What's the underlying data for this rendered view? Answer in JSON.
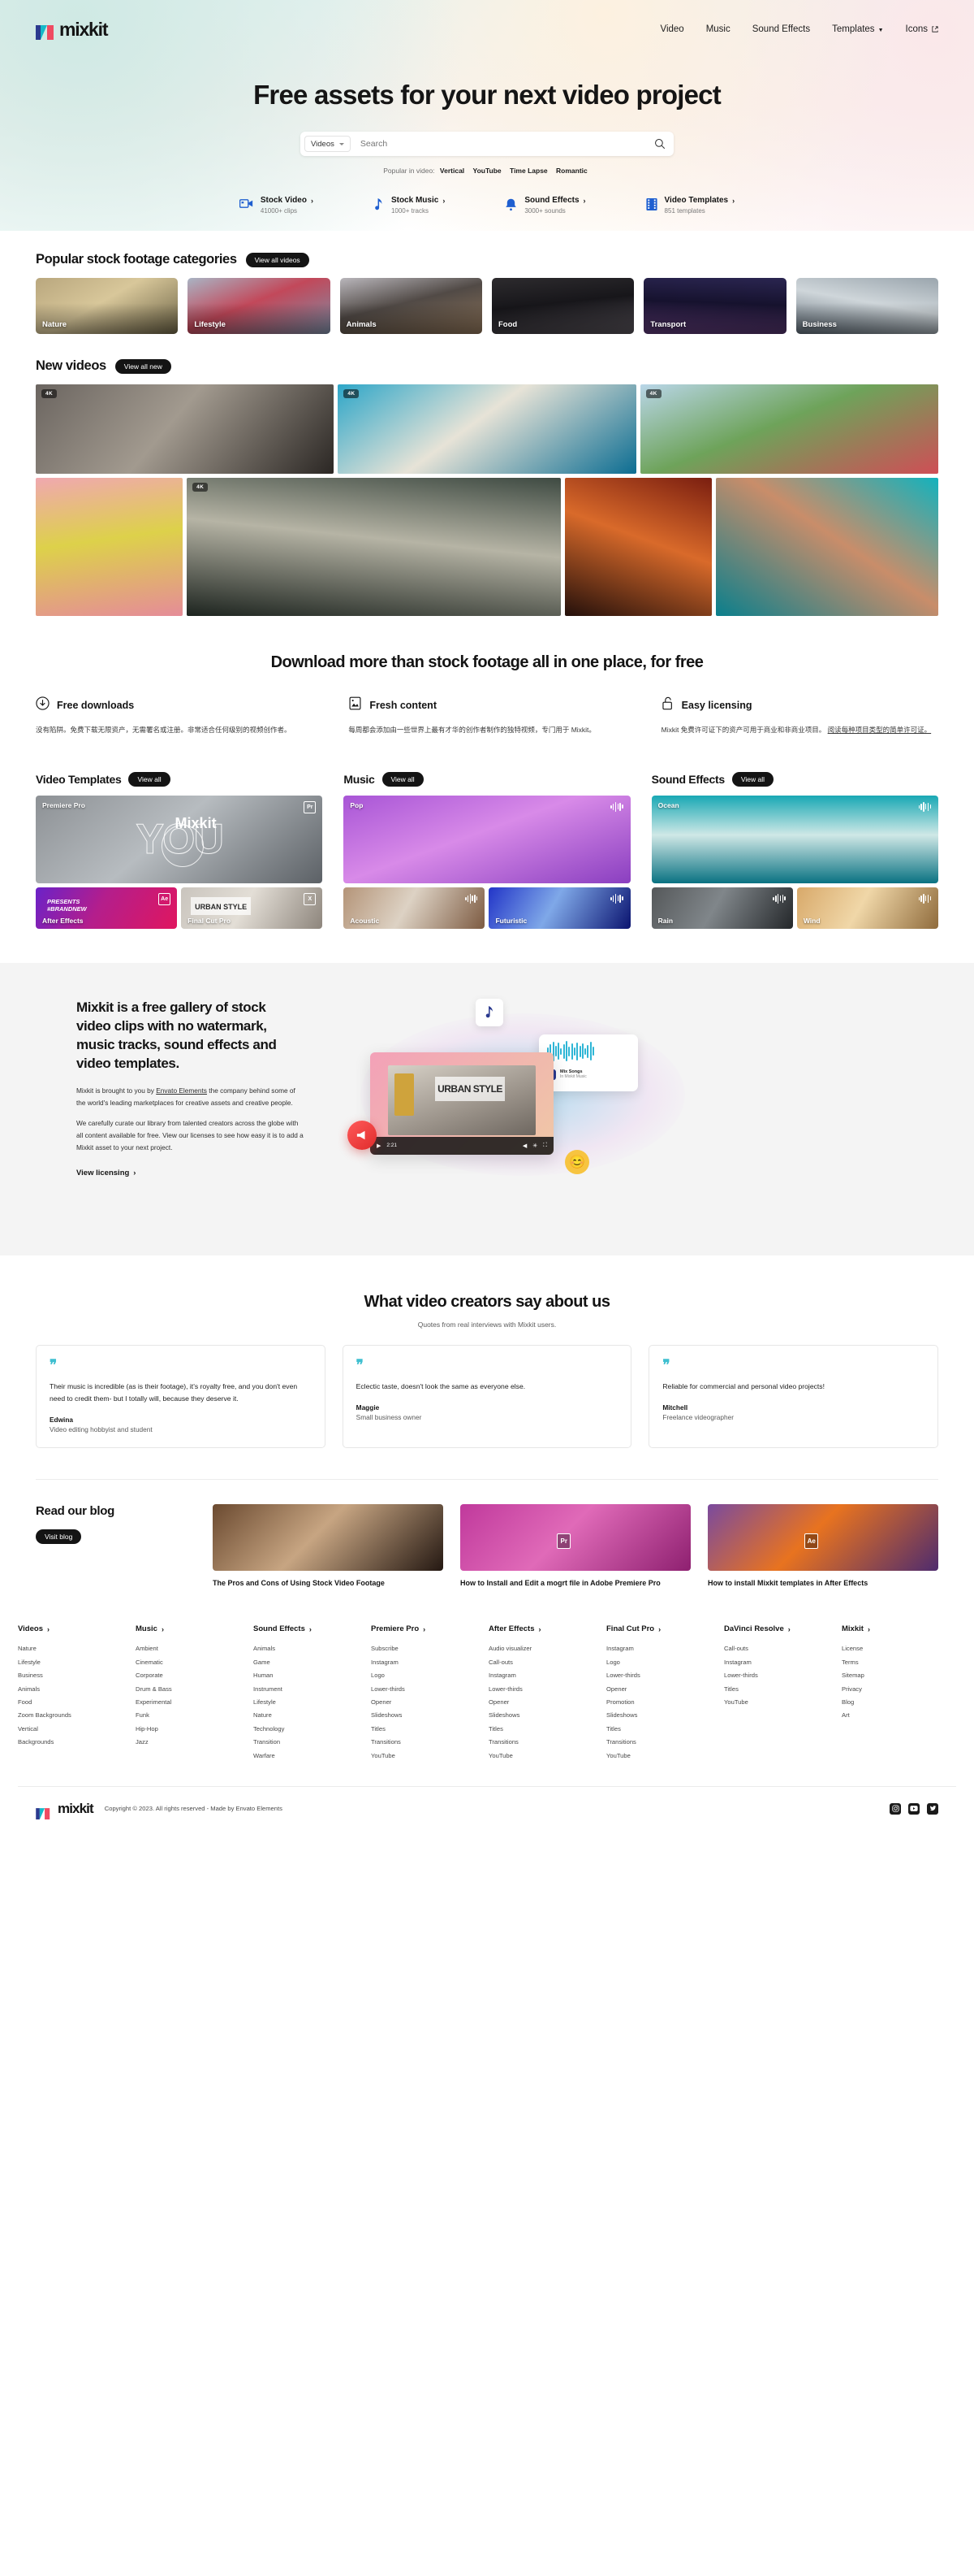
{
  "header": {
    "logo_text": "mixkit",
    "nav": [
      {
        "label": "Video",
        "icon": ""
      },
      {
        "label": "Music",
        "icon": ""
      },
      {
        "label": "Sound Effects",
        "icon": ""
      },
      {
        "label": "Templates",
        "icon": "chevron-down-icon"
      },
      {
        "label": "Icons",
        "icon": "external-link-icon"
      }
    ]
  },
  "hero": {
    "title": "Free assets for your next video project",
    "search": {
      "selector_label": "Videos",
      "placeholder": "Search",
      "value": "",
      "button_icon": "search-icon"
    },
    "popular_prefix": "Popular in video:",
    "popular_terms": [
      "Vertical",
      "YouTube",
      "Time Lapse",
      "Romantic"
    ],
    "quicklinks": [
      {
        "title": "Stock Video",
        "sub": "41000+ clips",
        "icon": "video-camera-icon"
      },
      {
        "title": "Stock Music",
        "sub": "1000+ tracks",
        "icon": "music-note-icon"
      },
      {
        "title": "Sound Effects",
        "sub": "3000+ sounds",
        "icon": "bell-icon"
      },
      {
        "title": "Video Templates",
        "sub": "851 templates",
        "icon": "film-strip-icon"
      }
    ]
  },
  "categories_section": {
    "title": "Popular stock footage categories",
    "cta": "View all videos",
    "items": [
      {
        "label": "Nature",
        "c1": "#b9a77e",
        "c2": "#6e6547",
        "c3": "#d8c79a"
      },
      {
        "label": "Lifestyle",
        "c1": "#a9b4c4",
        "c2": "#7d8ea6",
        "c3": "#c2485a"
      },
      {
        "label": "Animals",
        "c1": "#b9b6bb",
        "c2": "#8e7459",
        "c3": "#514a46"
      },
      {
        "label": "Food",
        "c1": "#2d2b2e",
        "c2": "#575259",
        "c3": "#17161a"
      },
      {
        "label": "Transport",
        "c1": "#2a2550",
        "c2": "#5d3a76",
        "c3": "#16122e"
      },
      {
        "label": "Business",
        "c1": "#9aa5ad",
        "c2": "#5d6a75",
        "c3": "#cfd6da"
      }
    ]
  },
  "new_videos_section": {
    "title": "New videos",
    "cta": "View all new",
    "badge": "4K",
    "tiles": [
      {
        "name": "woman-at-window",
        "badge": true,
        "c1": "#6b6560",
        "c2": "#2b2724",
        "c3": "#a29a8f"
      },
      {
        "name": "beach-waves",
        "badge": true,
        "c1": "#2da6c8",
        "c2": "#0c6d92",
        "c3": "#e7e3d7"
      },
      {
        "name": "girl-in-poppies",
        "badge": true,
        "c1": "#b9d6e8",
        "c2": "#cf4e56",
        "c3": "#6ea35a"
      },
      {
        "name": "pink-flower-hand",
        "badge": false,
        "c1": "#f0a8b0",
        "c2": "#e58c98",
        "c3": "#ddd14a"
      },
      {
        "name": "dog-in-river",
        "badge": true,
        "c1": "#3e4a42",
        "c2": "#1d241f",
        "c3": "#b6b4a5"
      },
      {
        "name": "goldfish",
        "badge": false,
        "c1": "#7a1e10",
        "c2": "#24100b",
        "c3": "#d96a2a"
      },
      {
        "name": "woman-sunglasses",
        "badge": false,
        "c1": "#13b2bd",
        "c2": "#0a7f8c",
        "c3": "#c98d6a"
      }
    ]
  },
  "download_section": {
    "title": "Download more than stock footage all in one place, for free",
    "features": [
      {
        "icon": "download-circle-icon",
        "title": "Free downloads",
        "body": "没有陷阱。免费下载无限资产，无需署名或注册。非常适合任何级别的视频创作者。",
        "link": ""
      },
      {
        "icon": "image-icon",
        "title": "Fresh content",
        "body": "每周都会添加由一些世界上最有才华的创作者制作的独特视频，专门用于 Mixkit。",
        "link": ""
      },
      {
        "icon": "lock-open-icon",
        "title": "Easy licensing",
        "body": "Mixkit 免费许可证下的资产可用于商业和非商业项目。",
        "link": "阅读每种项目类型的简单许可证。"
      }
    ]
  },
  "trio": [
    {
      "title": "Video Templates",
      "cta": "View all",
      "big": {
        "label": "Premiere Pro",
        "badge": "Pr",
        "overlay_word": "YOU",
        "overlay_brand": "Mixkit",
        "c1": "#8d9195",
        "c2": "#5c6166",
        "c3": "#b7bcc0"
      },
      "small": [
        {
          "label": "After Effects",
          "badge": "Ae",
          "c1": "#6a22c8",
          "c2": "#e0165f",
          "c3": "#b41e8c"
        },
        {
          "label": "Final Cut Pro",
          "badge": "X",
          "overlay_word": "URBAN STYLE",
          "c1": "#c9c4bd",
          "c2": "#8d857c",
          "c3": "#e3ded6"
        }
      ]
    },
    {
      "title": "Music",
      "cta": "View all",
      "big": {
        "label": "Pop",
        "badge": "",
        "icon": "waveform-icon",
        "c1": "#a855d6",
        "c2": "#8a3fc0",
        "c3": "#d88ae8"
      },
      "small": [
        {
          "label": "Acoustic",
          "icon": "waveform-icon",
          "c1": "#b49478",
          "c2": "#7d5b42",
          "c3": "#ddd2c4"
        },
        {
          "label": "Futuristic",
          "icon": "waveform-icon",
          "c1": "#2235c8",
          "c2": "#0b1470",
          "c3": "#7fa8e8"
        }
      ]
    },
    {
      "title": "Sound Effects",
      "cta": "View all",
      "big": {
        "label": "Ocean",
        "badge": "",
        "icon": "waveform-icon",
        "c1": "#18a8b4",
        "c2": "#0a7282",
        "c3": "#cfe8e6"
      },
      "small": [
        {
          "label": "Rain",
          "icon": "waveform-icon",
          "c1": "#55585a",
          "c2": "#24272a",
          "c3": "#80868a"
        },
        {
          "label": "Wind",
          "icon": "waveform-icon",
          "c1": "#d8a96a",
          "c2": "#8f6b3c",
          "c3": "#f0d7a8"
        }
      ]
    }
  ],
  "about": {
    "heading": "Mixkit is a free gallery of stock video clips with no watermark, music tracks, sound effects and video templates.",
    "p1_a": "Mixkit is brought to you by ",
    "p1_link": "Envato Elements",
    "p1_b": " the company behind some of the world's leading marketplaces for creative assets and creative people.",
    "p2": "We carefully curate our library from talented creators across the globe with all content available for free. View our licenses to see how easy it is to add a Mixkit asset to your next project.",
    "cta": "View licensing",
    "player": {
      "time": "2:21",
      "overlay_word": "URBAN STYLE",
      "track_title": "Mix Songs",
      "track_sub": "In Mixkit Music"
    }
  },
  "testimonials": {
    "title": "What video creators say about us",
    "subtitle": "Quotes from real interviews with Mixkit users.",
    "quote_mark": "❞",
    "items": [
      {
        "text": "Their music is incredible (as is their footage), it's royalty free, and you don't even need to credit them- but I totally will, because they deserve it.",
        "name": "Edwina",
        "role": "Video editing hobbyist and student"
      },
      {
        "text": "Eclectic taste, doesn't look the same as everyone else.",
        "name": "Maggie",
        "role": "Small business owner"
      },
      {
        "text": "Reliable for commercial and personal video projects!",
        "name": "Mitchell",
        "role": "Freelance videographer"
      }
    ]
  },
  "blog": {
    "title": "Read our blog",
    "cta": "Visit blog",
    "posts": [
      {
        "title": "The Pros and Cons of Using Stock Video Footage",
        "c1": "#6b4a30",
        "c2": "#241812",
        "c3": "#c7a582"
      },
      {
        "title": "How to Install and Edit a mogrt file in Adobe Premiere Pro",
        "badge": "Pr",
        "c1": "#c0399c",
        "c2": "#8e2070",
        "c3": "#e06ab8"
      },
      {
        "title": "How to install Mixkit templates in After Effects",
        "badge": "Ae",
        "c1": "#7a4a9e",
        "c2": "#4e2b6e",
        "c3": "#e8731f"
      }
    ]
  },
  "footer": {
    "columns": [
      {
        "heading": "Videos",
        "links": [
          "Nature",
          "Lifestyle",
          "Business",
          "Animals",
          "Food",
          "Zoom Backgrounds",
          "Vertical",
          "Backgrounds"
        ]
      },
      {
        "heading": "Music",
        "links": [
          "Ambient",
          "Cinematic",
          "Corporate",
          "Drum & Bass",
          "Experimental",
          "Funk",
          "Hip-Hop",
          "Jazz"
        ]
      },
      {
        "heading": "Sound Effects",
        "links": [
          "Animals",
          "Game",
          "Human",
          "Instrument",
          "Lifestyle",
          "Nature",
          "Technology",
          "Transition",
          "Warfare"
        ]
      },
      {
        "heading": "Premiere Pro",
        "links": [
          "Subscribe",
          "Instagram",
          "Logo",
          "Lower-thirds",
          "Opener",
          "Slideshows",
          "Titles",
          "Transitions",
          "YouTube"
        ]
      },
      {
        "heading": "After Effects",
        "links": [
          "Audio visualizer",
          "Call-outs",
          "Instagram",
          "Lower-thirds",
          "Opener",
          "Slideshows",
          "Titles",
          "Transitions",
          "YouTube"
        ]
      },
      {
        "heading": "Final Cut Pro",
        "links": [
          "Instagram",
          "Logo",
          "Lower-thirds",
          "Opener",
          "Promotion",
          "Slideshows",
          "Titles",
          "Transitions",
          "YouTube"
        ]
      },
      {
        "heading": "DaVinci Resolve",
        "links": [
          "Call-outs",
          "Instagram",
          "Lower-thirds",
          "Titles",
          "YouTube"
        ]
      },
      {
        "heading": "Mixkit",
        "links": [
          "License",
          "Terms",
          "Sitemap",
          "Privacy",
          "Blog",
          "Art"
        ]
      }
    ],
    "logo_text": "mixkit",
    "copyright_a": "Copyright © 2023. All rights reserved - Made by ",
    "copyright_link": "Envato Elements",
    "socials": [
      "instagram-icon",
      "youtube-icon",
      "twitter-icon"
    ]
  },
  "colors": {
    "accent_blue": "#1f5fd0",
    "dark": "#141414",
    "teal": "#3fbfd0"
  }
}
